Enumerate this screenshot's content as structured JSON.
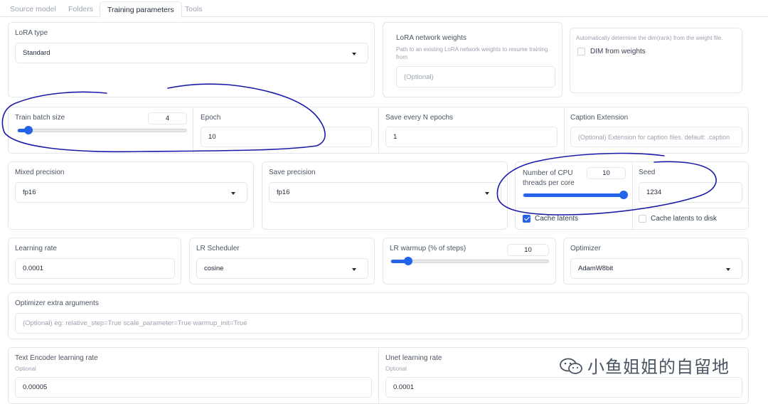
{
  "tabs": [
    "Source model",
    "Folders",
    "Training parameters",
    "Tools"
  ],
  "lora_type": {
    "label": "LoRA type",
    "value": "Standard"
  },
  "network_weights": {
    "label": "LoRA network weights",
    "help": "Path to an existing LoRA network weights to resume training from",
    "placeholder": "(Optional)"
  },
  "dim_from_weights": {
    "help": "Automatically determine the dim(rank) from the weight file.",
    "label": "DIM from weights",
    "checked": false
  },
  "train_batch_size": {
    "label": "Train batch size",
    "value": "4",
    "slider_fraction": 0.05
  },
  "epoch": {
    "label": "Epoch",
    "value": "10"
  },
  "save_every_n_epochs": {
    "label": "Save every N epochs",
    "value": "1"
  },
  "caption_extension": {
    "label": "Caption Extension",
    "placeholder": "(Optional) Extension for caption files. default: .caption"
  },
  "mixed_precision": {
    "label": "Mixed precision",
    "value": "fp16"
  },
  "save_precision": {
    "label": "Save precision",
    "value": "fp16"
  },
  "cpu_threads": {
    "label": "Number of CPU threads per core",
    "value": "10",
    "slider_fraction": 1.0
  },
  "seed": {
    "label": "Seed",
    "value": "1234"
  },
  "cache_latents": {
    "label": "Cache latents",
    "checked": true
  },
  "cache_latents_to_disk": {
    "label": "Cache latents to disk",
    "checked": false
  },
  "learning_rate": {
    "label": "Learning rate",
    "value": "0.0001"
  },
  "lr_scheduler": {
    "label": "LR Scheduler",
    "value": "cosine"
  },
  "lr_warmup": {
    "label": "LR warmup (% of steps)",
    "value": "10",
    "slider_fraction": 0.1
  },
  "optimizer": {
    "label": "Optimizer",
    "value": "AdamW8bit"
  },
  "optimizer_args": {
    "label": "Optimizer extra arguments",
    "placeholder": "(Optional) eg: relative_step=True scale_parameter=True warmup_init=True"
  },
  "text_encoder_lr": {
    "label": "Text Encoder learning rate",
    "sub": "Optional",
    "value": "0.00005"
  },
  "unet_lr": {
    "label": "Unet learning rate",
    "sub": "Optional",
    "value": "0.0001"
  },
  "watermark": {
    "text": "小鱼姐姐的自留地",
    "icon": "wechat-icon"
  },
  "colors": {
    "accent": "#2563eb",
    "annotation_ink": "#1a1aa8",
    "border": "#e5e7eb"
  }
}
